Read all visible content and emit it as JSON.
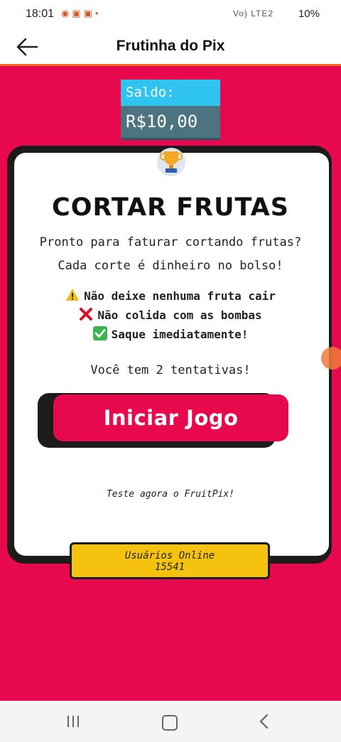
{
  "status_bar": {
    "time": "18:01",
    "battery": "10%",
    "network": "Vo) LTE2"
  },
  "app_bar": {
    "title": "Frutinha do Pix",
    "back_icon": "arrow-left-icon"
  },
  "balance": {
    "label": "Saldo:",
    "value": "R$10,00"
  },
  "game_card": {
    "trophy_icon": "trophy-icon",
    "heading": "CORTAR FRUTAS",
    "intro_line1": "Pronto para faturar cortando frutas?",
    "intro_line2": "Cada corte é dinheiro no bolso!",
    "rules": [
      {
        "icon": "warning-icon",
        "text": "Não deixe nenhuma fruta cair"
      },
      {
        "icon": "cross-mark-icon",
        "text": "Não colida com as bombas"
      },
      {
        "icon": "check-mark-icon",
        "text": "Saque imediatamente!"
      }
    ],
    "attempts": "Você tem 2 tentativas!",
    "start_button": "Iniciar Jogo",
    "tagline": "Teste agora o FruitPix!"
  },
  "online_users": {
    "label": "Usuários Online",
    "count": "15541"
  },
  "colors": {
    "background": "#e8084e",
    "balance_label_bg": "#2fc4ef",
    "balance_value_bg": "#4b7380",
    "online_bg": "#f5c20f",
    "appbar_accent": "#f06a1c"
  }
}
